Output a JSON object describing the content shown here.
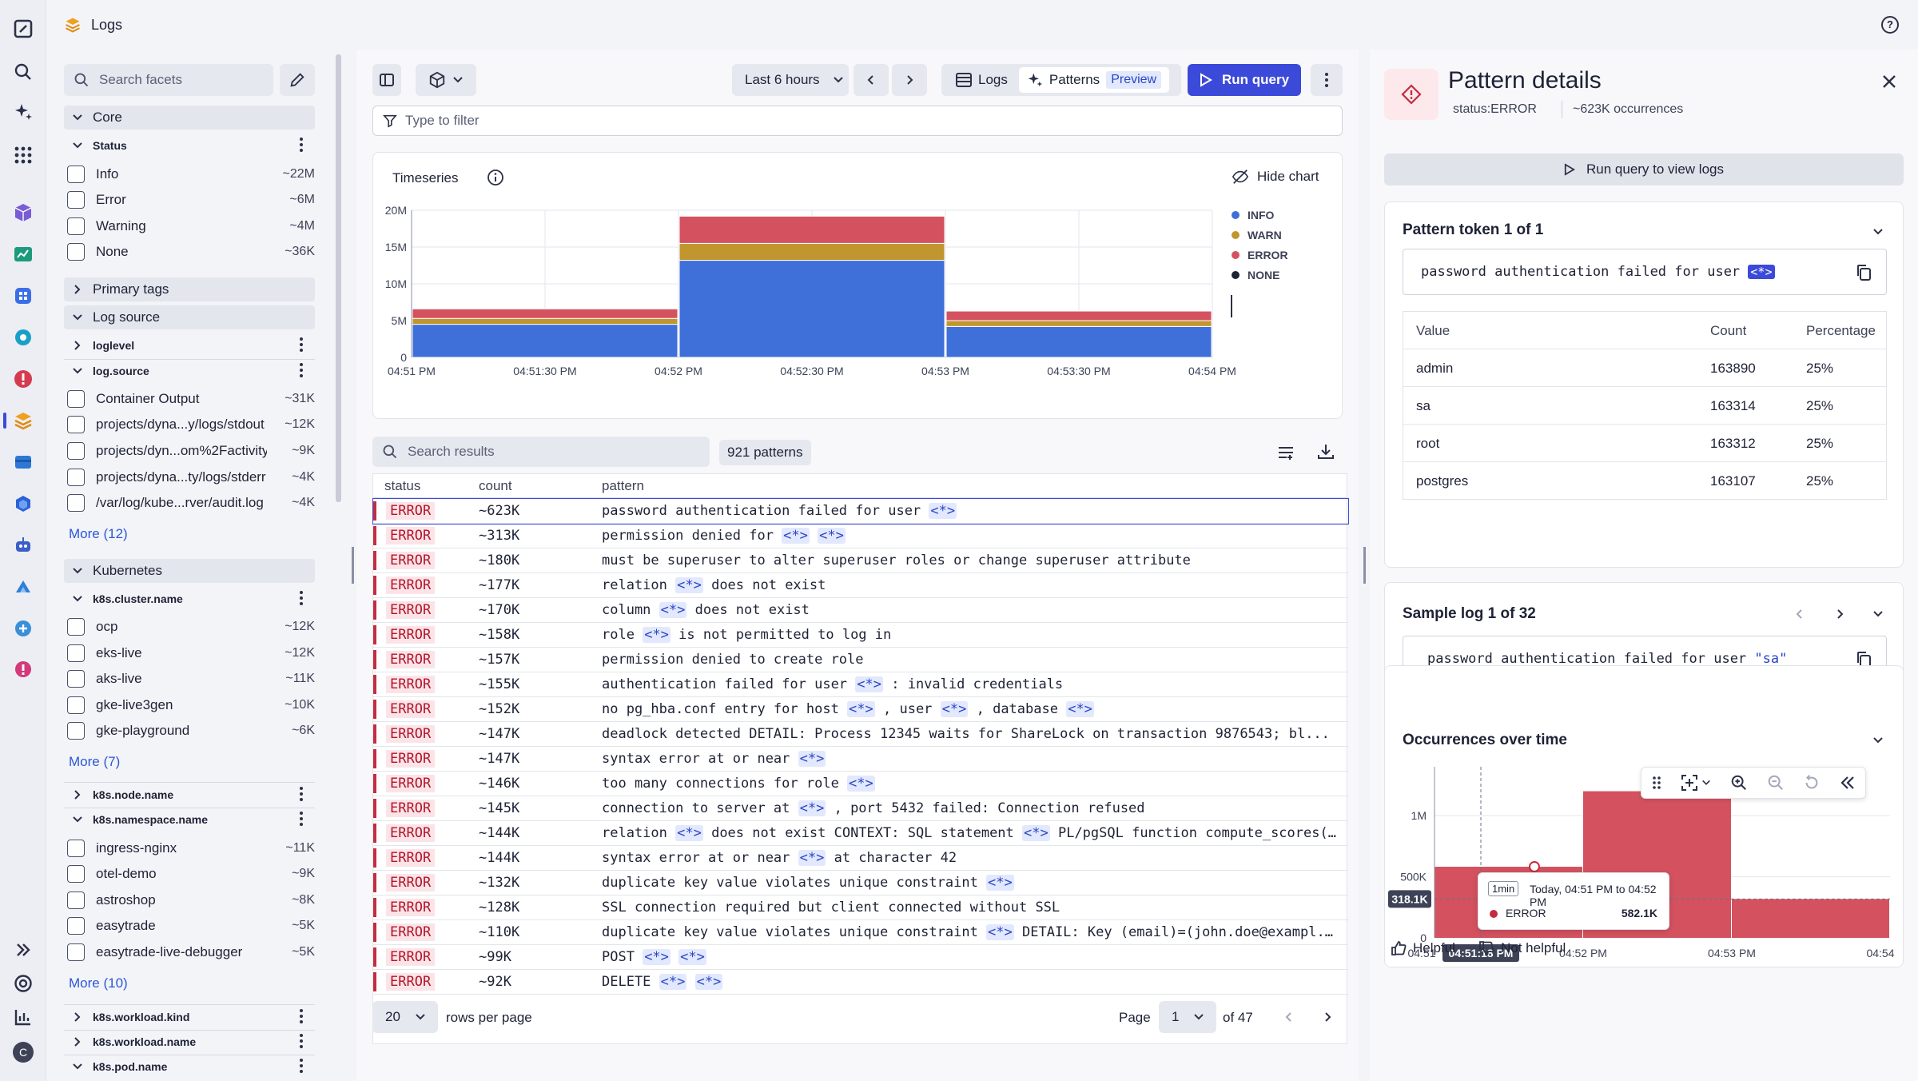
{
  "app": {
    "title": "Logs",
    "help": "?"
  },
  "facets": {
    "search_placeholder": "Search facets",
    "core_label": "Core",
    "status_label": "Status",
    "status_items": [
      {
        "label": "Info",
        "count": "~22M"
      },
      {
        "label": "Error",
        "count": "~6M"
      },
      {
        "label": "Warning",
        "count": "~4M"
      },
      {
        "label": "None",
        "count": "~36K"
      }
    ],
    "primary_tags_label": "Primary tags",
    "log_source_label": "Log source",
    "loglevel_label": "loglevel",
    "logsource_label": "log.source",
    "logsource_items": [
      {
        "label": "Container Output",
        "count": "~31K"
      },
      {
        "label": "projects/dyna...y/logs/stdout",
        "count": "~12K"
      },
      {
        "label": "projects/dyn...om%2Factivity",
        "count": "~9K"
      },
      {
        "label": "projects/dyna...ty/logs/stderr",
        "count": "~4K"
      },
      {
        "label": "/var/log/kube...rver/audit.log",
        "count": "~4K"
      }
    ],
    "more_logsource": "More (12)",
    "kubernetes_label": "Kubernetes",
    "cluster_label": "k8s.cluster.name",
    "cluster_items": [
      {
        "label": "ocp",
        "count": "~12K"
      },
      {
        "label": "eks-live",
        "count": "~12K"
      },
      {
        "label": "aks-live",
        "count": "~11K"
      },
      {
        "label": "gke-live3gen",
        "count": "~10K"
      },
      {
        "label": "gke-playground",
        "count": "~6K"
      }
    ],
    "more_cluster": "More (7)",
    "node_label": "k8s.node.name",
    "namespace_label": "k8s.namespace.name",
    "namespace_items": [
      {
        "label": "ingress-nginx",
        "count": "~11K"
      },
      {
        "label": "otel-demo",
        "count": "~9K"
      },
      {
        "label": "astroshop",
        "count": "~8K"
      },
      {
        "label": "easytrade",
        "count": "~5K"
      },
      {
        "label": "easytrade-live-debugger",
        "count": "~5K"
      }
    ],
    "more_namespace": "More (10)",
    "workload_kind_label": "k8s.workload.kind",
    "workload_name_label": "k8s.workload.name",
    "pod_label": "k8s.pod.name"
  },
  "toolbar": {
    "timeframe": "Last 6 hours",
    "logs_label": "Logs",
    "patterns_label": "Patterns",
    "preview_label": "Preview",
    "run_query": "Run query",
    "filter_placeholder": "Type to filter"
  },
  "timeseries": {
    "title": "Timeseries",
    "hide_chart": "Hide chart",
    "y_ticks": [
      "20M",
      "15M",
      "10M",
      "5M",
      "0"
    ],
    "x_ticks": [
      "04:51 PM",
      "04:51:30 PM",
      "04:52 PM",
      "04:52:30 PM",
      "04:53 PM",
      "04:53:30 PM",
      "04:54 PM"
    ]
  },
  "chart_data": [
    {
      "type": "bar",
      "stacked": true,
      "categories": [
        "04:51 PM",
        "04:52 PM",
        "04:53 PM"
      ],
      "ylim": [
        0,
        20000000
      ],
      "grid": true,
      "legend": "right",
      "series": [
        {
          "name": "INFO",
          "color": "#3f6fd8",
          "values": [
            4500000,
            13200000,
            4200000
          ]
        },
        {
          "name": "WARN",
          "color": "#c2962e",
          "values": [
            800000,
            2300000,
            800000
          ]
        },
        {
          "name": "ERROR",
          "color": "#d4525f",
          "values": [
            1300000,
            3700000,
            1300000
          ]
        },
        {
          "name": "NONE",
          "color": "#1e2235",
          "values": [
            0,
            0,
            0
          ]
        }
      ]
    },
    {
      "type": "bar",
      "categories": [
        "04:51 PM",
        "04:52 PM",
        "04:53 PM"
      ],
      "series": [
        {
          "name": "ERROR",
          "color": "#d4525f",
          "values": [
            582100,
            1200000,
            318100
          ]
        }
      ],
      "ylim": [
        0,
        1400000
      ],
      "y_ticks": [
        "1M",
        "500K",
        "0"
      ],
      "x_ticks": [
        "04:51",
        "04:52 PM",
        "04:53 PM",
        "04:54"
      ],
      "crosshair_value": "318.1K",
      "crosshair_time": "04:51:18 PM",
      "tooltip": {
        "badge": "1min",
        "range": "Today, 04:51 PM to 04:52 PM",
        "series": "ERROR",
        "value": "582.1K"
      }
    }
  ],
  "results": {
    "search_placeholder": "Search results",
    "patterns_count": "921 patterns",
    "columns": [
      "status",
      "count",
      "pattern"
    ],
    "rows": [
      {
        "status": "ERROR",
        "count": "~623K",
        "pattern": [
          {
            "t": "password authentication failed for user "
          },
          {
            "k": "<*>"
          }
        ]
      },
      {
        "status": "ERROR",
        "count": "~313K",
        "pattern": [
          {
            "t": "permission denied for "
          },
          {
            "k": "<*>"
          },
          {
            "t": " "
          },
          {
            "k": "<*>"
          }
        ]
      },
      {
        "status": "ERROR",
        "count": "~180K",
        "pattern": [
          {
            "t": "must be superuser to alter superuser roles or change superuser attribute"
          }
        ]
      },
      {
        "status": "ERROR",
        "count": "~177K",
        "pattern": [
          {
            "t": "relation "
          },
          {
            "k": "<*>"
          },
          {
            "t": " does not exist"
          }
        ]
      },
      {
        "status": "ERROR",
        "count": "~170K",
        "pattern": [
          {
            "t": "column "
          },
          {
            "k": "<*>"
          },
          {
            "t": " does not exist"
          }
        ]
      },
      {
        "status": "ERROR",
        "count": "~158K",
        "pattern": [
          {
            "t": "role "
          },
          {
            "k": "<*>"
          },
          {
            "t": " is not permitted to log in"
          }
        ]
      },
      {
        "status": "ERROR",
        "count": "~157K",
        "pattern": [
          {
            "t": "permission denied to create role"
          }
        ]
      },
      {
        "status": "ERROR",
        "count": "~155K",
        "pattern": [
          {
            "t": "authentication failed for user "
          },
          {
            "k": "<*>"
          },
          {
            "t": " : invalid credentials"
          }
        ]
      },
      {
        "status": "ERROR",
        "count": "~152K",
        "pattern": [
          {
            "t": "no pg_hba.conf entry for host "
          },
          {
            "k": "<*>"
          },
          {
            "t": " , user "
          },
          {
            "k": "<*>"
          },
          {
            "t": " , database "
          },
          {
            "k": "<*>"
          }
        ]
      },
      {
        "status": "ERROR",
        "count": "~147K",
        "pattern": [
          {
            "t": "deadlock detected DETAIL: Process 12345 waits for ShareLock on transaction 9876543; bl..."
          }
        ]
      },
      {
        "status": "ERROR",
        "count": "~147K",
        "pattern": [
          {
            "t": "syntax error at or near "
          },
          {
            "k": "<*>"
          }
        ]
      },
      {
        "status": "ERROR",
        "count": "~146K",
        "pattern": [
          {
            "t": "too many connections for role "
          },
          {
            "k": "<*>"
          }
        ]
      },
      {
        "status": "ERROR",
        "count": "~145K",
        "pattern": [
          {
            "t": "connection to server at "
          },
          {
            "k": "<*>"
          },
          {
            "t": " , port 5432 failed: Connection refused"
          }
        ]
      },
      {
        "status": "ERROR",
        "count": "~144K",
        "pattern": [
          {
            "t": "relation "
          },
          {
            "k": "<*>"
          },
          {
            "t": " does not exist CONTEXT: SQL statement "
          },
          {
            "k": "<*>"
          },
          {
            "t": " PL/pgSQL function compute_scores(..."
          }
        ]
      },
      {
        "status": "ERROR",
        "count": "~144K",
        "pattern": [
          {
            "t": "syntax error at or near "
          },
          {
            "k": "<*>"
          },
          {
            "t": " at character 42"
          }
        ]
      },
      {
        "status": "ERROR",
        "count": "~132K",
        "pattern": [
          {
            "t": "duplicate key value violates unique constraint "
          },
          {
            "k": "<*>"
          }
        ]
      },
      {
        "status": "ERROR",
        "count": "~128K",
        "pattern": [
          {
            "t": "SSL connection required but client connected without SSL"
          }
        ]
      },
      {
        "status": "ERROR",
        "count": "~110K",
        "pattern": [
          {
            "t": "duplicate key value violates unique constraint "
          },
          {
            "k": "<*>"
          },
          {
            "t": " DETAIL: Key (email)=(john.doe@exampl..."
          }
        ]
      },
      {
        "status": "ERROR",
        "count": "~99K",
        "pattern": [
          {
            "t": "POST "
          },
          {
            "k": "<*>"
          },
          {
            "t": " "
          },
          {
            "k": "<*>"
          }
        ]
      },
      {
        "status": "ERROR",
        "count": "~92K",
        "pattern": [
          {
            "t": "DELETE "
          },
          {
            "k": "<*>"
          },
          {
            "t": " "
          },
          {
            "k": "<*>"
          }
        ]
      }
    ]
  },
  "pagination": {
    "rows_per_page_value": "20",
    "rows_per_page_label": "rows per page",
    "page_label": "Page",
    "page_value": "1",
    "of_label": "of 47"
  },
  "details": {
    "title": "Pattern details",
    "status_key": "status",
    "status_value": "ERROR",
    "occurrences": "~623K occurrences",
    "run_query_view": "Run query to view logs",
    "token_title": "Pattern token 1 of 1",
    "token_text": "password authentication failed for user ",
    "token_placeholder": "<*>",
    "value_columns": [
      "Value",
      "Count",
      "Percentage"
    ],
    "values": [
      {
        "value": "admin",
        "count": "163890",
        "pct": "25%"
      },
      {
        "value": "sa",
        "count": "163314",
        "pct": "25%"
      },
      {
        "value": "root",
        "count": "163312",
        "pct": "25%"
      },
      {
        "value": "postgres",
        "count": "163107",
        "pct": "25%"
      }
    ],
    "sample_title": "Sample log 1 of 32",
    "sample_text": "password authentication failed for user ",
    "sample_value": "\"sa\"",
    "occ_title": "Occurrences over time",
    "helpful": "Helpful",
    "not_helpful": "Not helpful"
  },
  "colors": {
    "accent": "#3b4ad9",
    "error": "#c42c3f",
    "info": "#3f6fd8",
    "warn": "#c2962e",
    "error_bar": "#d4525f"
  }
}
